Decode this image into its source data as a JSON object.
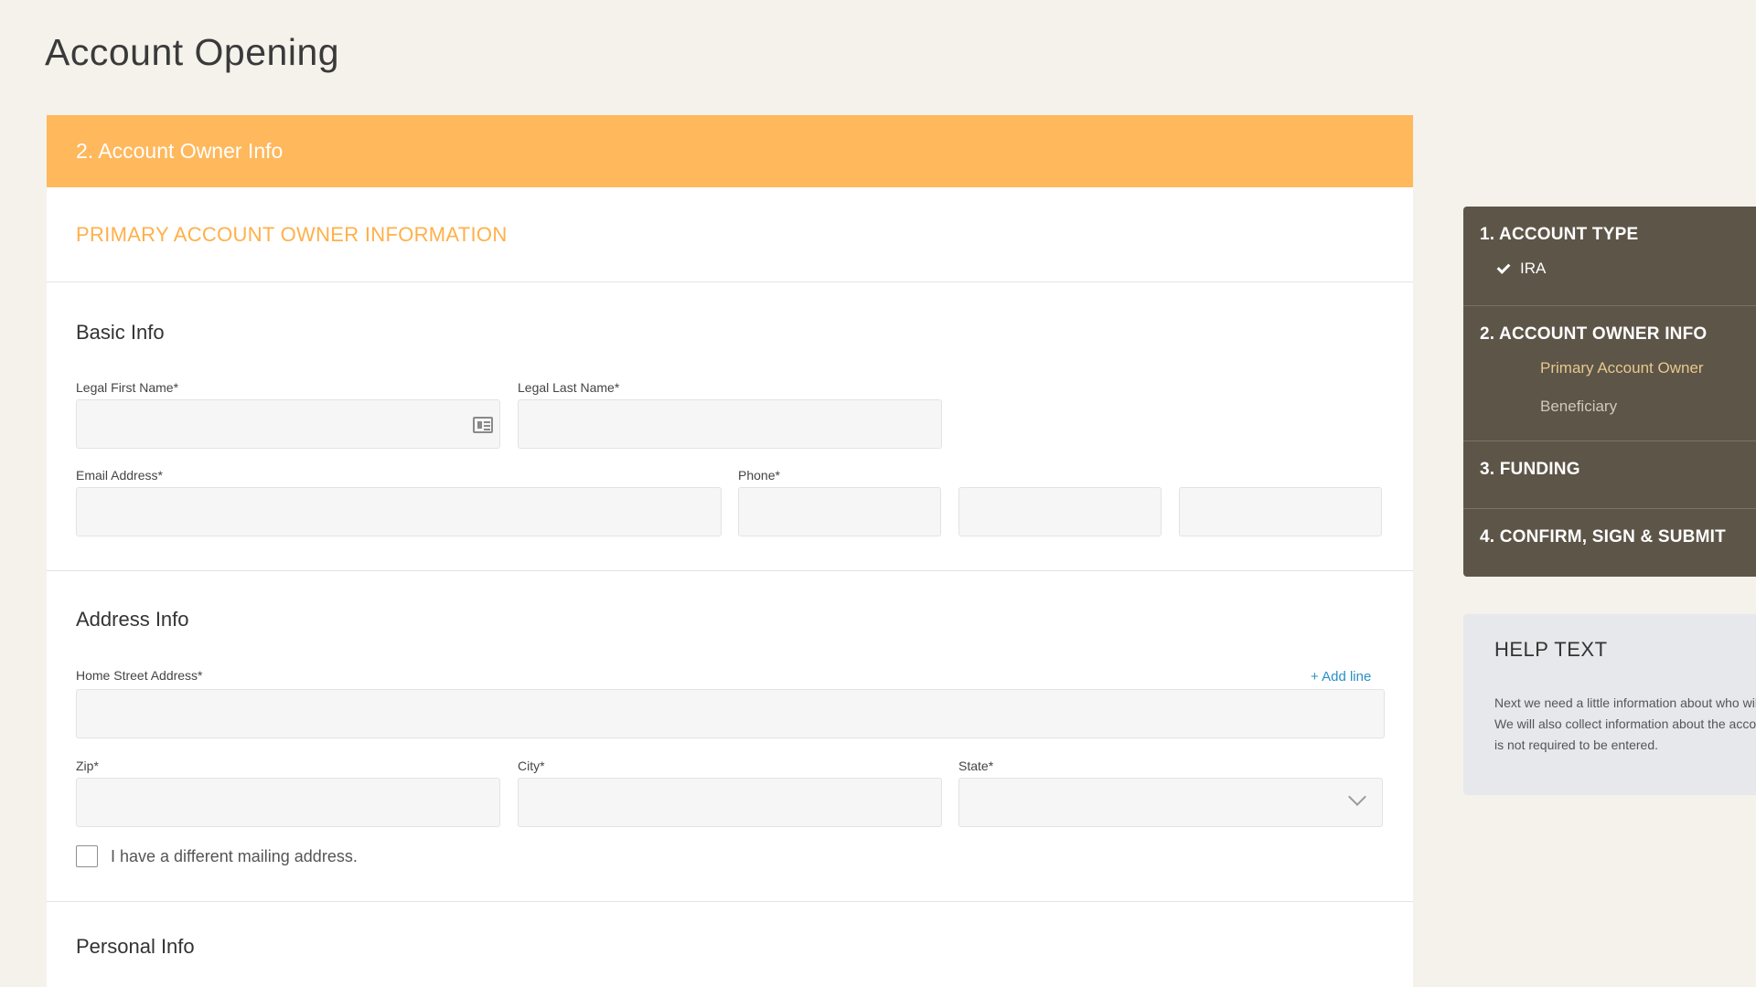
{
  "page_title": "Account Opening",
  "form": {
    "header": "2. Account Owner Info",
    "subheader": "PRIMARY ACCOUNT OWNER INFORMATION",
    "basic_info": {
      "title": "Basic Info",
      "first_name_label": "Legal First Name*",
      "last_name_label": "Legal Last Name*",
      "email_label": "Email Address*",
      "phone_label": "Phone*",
      "first_name_value": "",
      "last_name_value": "",
      "email_value": "",
      "phone_area_value": "",
      "phone_prefix_value": "",
      "phone_line_value": ""
    },
    "address_info": {
      "title": "Address Info",
      "street_label": "Home Street Address*",
      "add_line": "+ Add line",
      "zip_label": "Zip*",
      "city_label": "City*",
      "state_label": "State*",
      "street_value": "",
      "zip_value": "",
      "city_value": "",
      "state_value": "",
      "mailing_checkbox_label": "I have a different mailing address.",
      "mailing_checked": false
    },
    "personal_info": {
      "title": "Personal Info"
    }
  },
  "steps": [
    {
      "title": "1. ACCOUNT TYPE",
      "completed_value": "IRA"
    },
    {
      "title": "2. ACCOUNT OWNER INFO",
      "links": [
        "Primary Account Owner",
        "Beneficiary"
      ],
      "active_link": "Primary Account Owner"
    },
    {
      "title": "3. FUNDING"
    },
    {
      "title": "4. CONFIRM, SIGN & SUBMIT"
    }
  ],
  "help": {
    "title": "HELP TEXT",
    "body": "Next we need a little information about who will own this account. We will also collect information about the account beneficiary, but it is not required to be entered."
  },
  "colors": {
    "accent_orange": "#ffb85c",
    "nav_brown": "#5d5548",
    "link_blue": "#2a8fc7"
  }
}
